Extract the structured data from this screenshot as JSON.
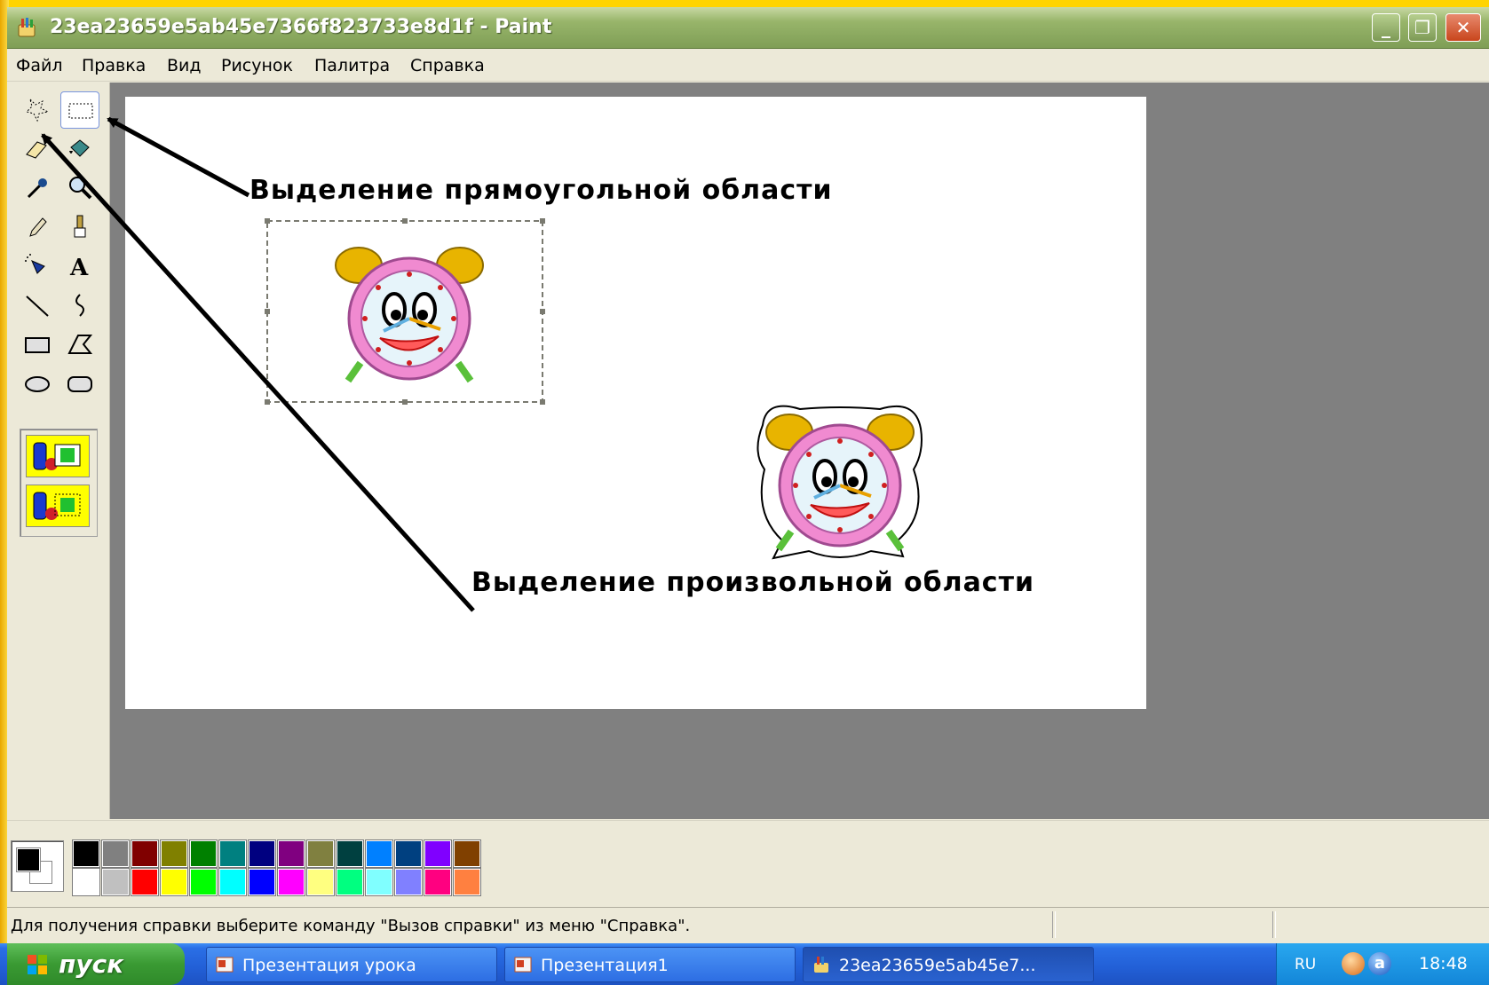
{
  "window": {
    "title": "23ea23659e5ab45e7366f823733e8d1f - Paint",
    "controls": {
      "minimize": "minimize",
      "maximize": "restore",
      "close": "close"
    }
  },
  "menubar": {
    "items": [
      "Файл",
      "Правка",
      "Вид",
      "Рисунок",
      "Палитра",
      "Справка"
    ]
  },
  "toolbox": {
    "tools": [
      {
        "icon": "free-form-select-icon"
      },
      {
        "icon": "rect-select-icon",
        "active": true
      },
      {
        "icon": "eraser-icon"
      },
      {
        "icon": "fill-bucket-icon"
      },
      {
        "icon": "color-picker-icon"
      },
      {
        "icon": "magnifier-icon"
      },
      {
        "icon": "pencil-icon"
      },
      {
        "icon": "brush-icon"
      },
      {
        "icon": "airbrush-icon"
      },
      {
        "icon": "text-icon"
      },
      {
        "icon": "line-icon"
      },
      {
        "icon": "curve-icon"
      },
      {
        "icon": "rectangle-icon"
      },
      {
        "icon": "polygon-icon"
      },
      {
        "icon": "ellipse-icon"
      },
      {
        "icon": "rounded-rect-icon"
      }
    ],
    "options": [
      "opaque-selection-icon",
      "transparent-selection-icon"
    ]
  },
  "canvas": {
    "annotation_rect": "Выделение прямоугольной области",
    "annotation_free": "Выделение произвольной области"
  },
  "palette": {
    "foreground": "#000000",
    "background": "#ffffff",
    "top_row": [
      "#000000",
      "#808080",
      "#800000",
      "#808000",
      "#008000",
      "#008080",
      "#000080",
      "#800080",
      "#808040",
      "#004040",
      "#0080ff",
      "#004080",
      "#8000ff",
      "#804000"
    ],
    "bottom_row": [
      "#ffffff",
      "#c0c0c0",
      "#ff0000",
      "#ffff00",
      "#00ff00",
      "#00ffff",
      "#0000ff",
      "#ff00ff",
      "#ffff80",
      "#00ff80",
      "#80ffff",
      "#8080ff",
      "#ff0080",
      "#ff8040"
    ]
  },
  "status": {
    "text": "Для получения справки выберите команду \"Вызов справки\" из меню \"Справка\"."
  },
  "taskbar": {
    "start": "пуск",
    "tasks": [
      {
        "label": "Презентация урока",
        "active": false
      },
      {
        "label": "Презентация1",
        "active": false
      },
      {
        "label": "23ea23659e5ab45e7...",
        "active": true
      }
    ],
    "tray": {
      "lang": "RU",
      "time": "18:48"
    }
  }
}
